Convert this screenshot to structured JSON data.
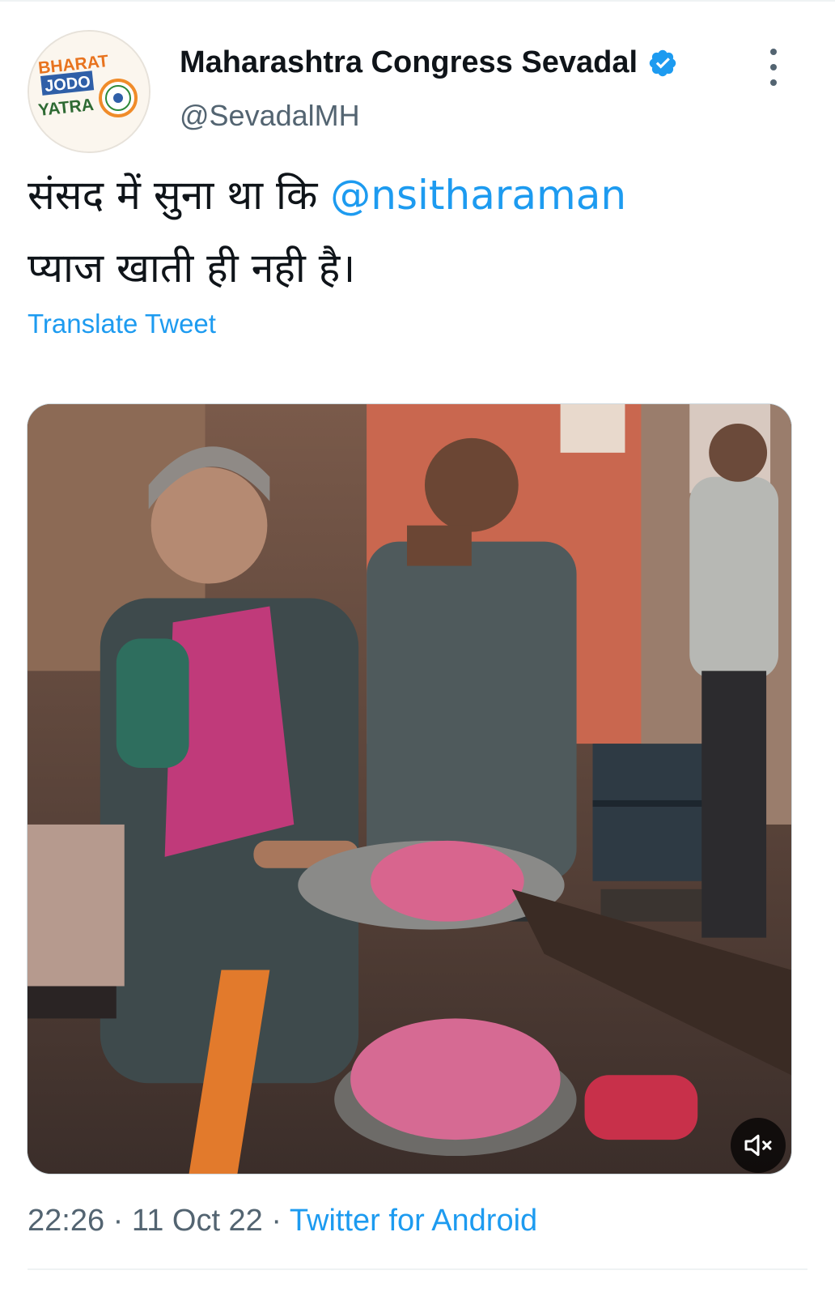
{
  "author": {
    "name": "Maharashtra Congress Sevadal",
    "handle": "@SevadalMH",
    "avatar_text": [
      "BHARAT",
      "JODO",
      "YATRA"
    ],
    "verified_color": "#1d9bf0"
  },
  "tweet": {
    "text_line1": "संसद में सुना था कि ",
    "mention": "@nsitharaman",
    "text_line2": "प्याज खाती ही नही है।",
    "translate_label": "Translate Tweet"
  },
  "media": {
    "type": "video",
    "mute_icon": "speaker-muted-icon"
  },
  "meta": {
    "time": "22:26",
    "separator": " · ",
    "date": "11 Oct 22",
    "source": "Twitter for Android"
  },
  "colors": {
    "link": "#1d9bf0",
    "secondary_text": "#536471",
    "primary_text": "#0f1419"
  }
}
